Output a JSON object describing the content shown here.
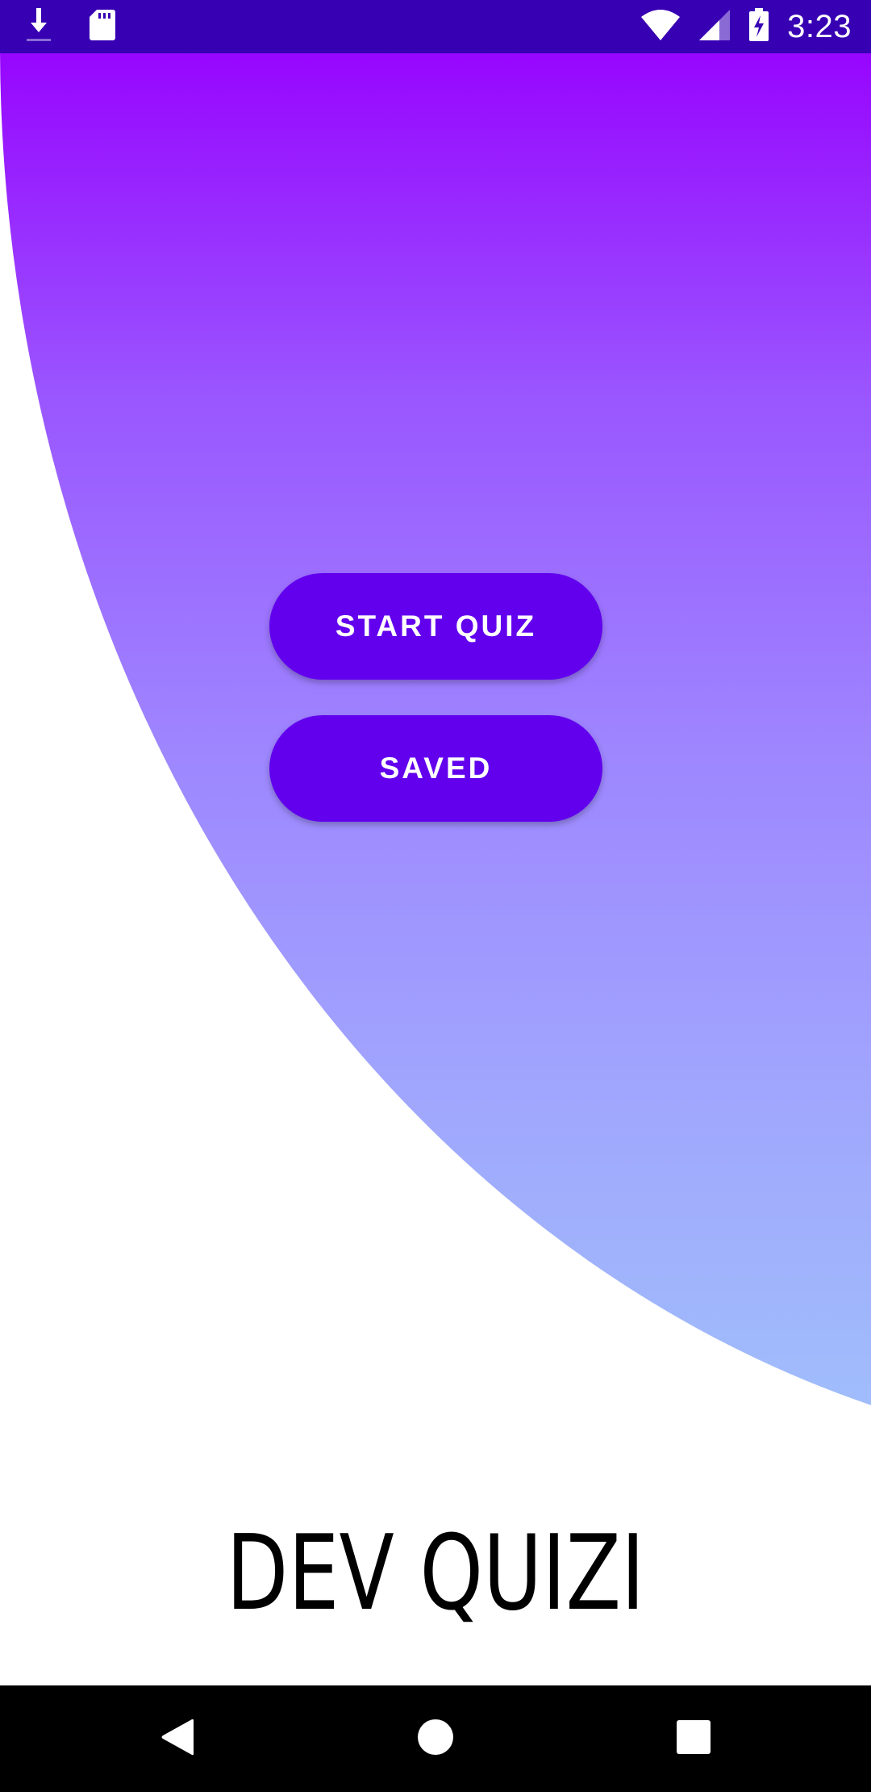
{
  "status_bar": {
    "time": "3:23",
    "left_icons": [
      "download-icon",
      "sd-card-icon"
    ],
    "right_icons": [
      "wifi-icon",
      "cell-signal-icon",
      "battery-charging-icon"
    ],
    "background_color": "#3700b3"
  },
  "main": {
    "start_quiz_label": "START QUIZ",
    "saved_label": "SAVED",
    "button_color": "#6200ee",
    "gradient_top_color": "#9407ff",
    "gradient_bottom_color": "#a0c1fb"
  },
  "footer": {
    "app_title": "DEV QUIZI"
  },
  "nav_bar": {
    "icons": [
      "back-icon",
      "home-icon",
      "recent-apps-icon"
    ]
  }
}
